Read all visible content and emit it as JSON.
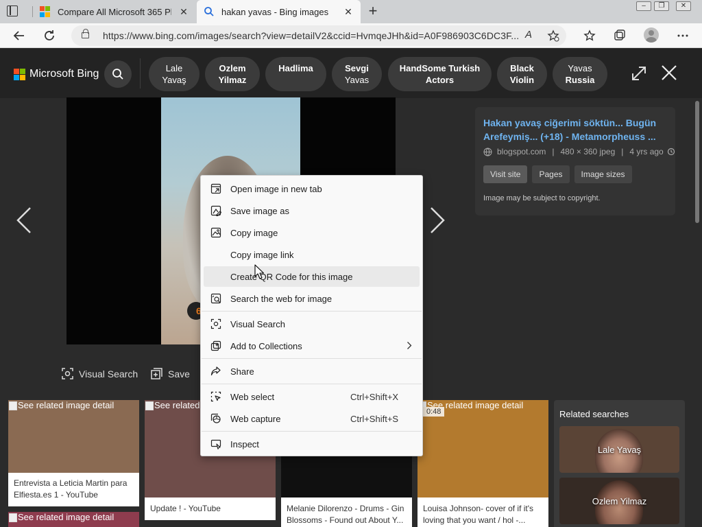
{
  "browser": {
    "tabs": [
      {
        "title": "Compare All Microsoft 365 Plans",
        "active": false
      },
      {
        "title": "hakan yavas - Bing images",
        "active": true
      }
    ],
    "new_tab_symbol": "+",
    "close_symbol": "✕",
    "window_controls": [
      "minimize-icon",
      "restore-icon",
      "close-icon"
    ],
    "url": "https://www.bing.com/images/search?view=detailV2&ccid=HvmqeJHh&id=A0F986903C6DC3F...",
    "read_aloud_label": "A",
    "toolbar_icons": [
      "read-aloud-icon",
      "add-favorite-icon",
      "favorites-icon",
      "collections-icon",
      "profile-icon",
      "more-icon"
    ]
  },
  "bing": {
    "logo_text": "Microsoft Bing",
    "logo_colors": [
      "#f25022",
      "#7fba00",
      "#00a4ef",
      "#ffb900"
    ],
    "chips": [
      {
        "line1": "Lale",
        "line2": "Yavaş"
      },
      {
        "line1": "Ozlem",
        "line2": "Yilmaz"
      },
      {
        "line1": "Hadlima",
        "line2": ""
      },
      {
        "line1": "Sevgi",
        "line2": "Yavas"
      },
      {
        "line1": "HandSome Turkish",
        "line2": "Actors"
      },
      {
        "line1": "Black",
        "line2": "Violin"
      },
      {
        "line1": "Yavas",
        "line2": "Russia"
      }
    ]
  },
  "viewer": {
    "badge_text": "6",
    "actions": {
      "visual_search": "Visual Search",
      "save": "Save"
    }
  },
  "info": {
    "title": "Hakan yavaş ciğerimi söktün... Bugün Arefeymiş... (+18) - Metamorpheuss ...",
    "source": "blogspot.com",
    "size": "480 × 360 jpeg",
    "age": "4 yrs ago",
    "buttons": [
      "Visit site",
      "Pages",
      "Image sizes"
    ],
    "note": "Image may be subject to copyright."
  },
  "related": {
    "alt_text": "See related image detail",
    "cards": [
      {
        "caption": "Entrevista a Leticia Martin para Elfiesta.es 1 - YouTube",
        "duration": ""
      },
      {
        "caption": "Update ! - YouTube",
        "duration": ""
      },
      {
        "caption": "Melanie Dilorenzo - Drums - Gin Blossoms - Found out About Y...",
        "duration": ""
      },
      {
        "caption": "Louisa Johnson- cover of if it's loving that you want / hol -...",
        "duration": "0:48"
      }
    ],
    "searches_title": "Related searches",
    "searches": [
      "Lale Yavaş",
      "Ozlem Yilmaz"
    ]
  },
  "context_menu": {
    "items": [
      {
        "label": "Open image in new tab",
        "icon": "new-tab-icon",
        "shortcut": ""
      },
      {
        "label": "Save image as",
        "icon": "save-image-icon",
        "shortcut": ""
      },
      {
        "label": "Copy image",
        "icon": "copy-image-icon",
        "shortcut": ""
      },
      {
        "label": "Copy image link",
        "icon": "",
        "shortcut": ""
      },
      {
        "label": "Create QR Code for this image",
        "icon": "",
        "shortcut": ""
      },
      {
        "label": "Search the web for image",
        "icon": "search-image-icon",
        "shortcut": ""
      },
      {
        "label": "Visual Search",
        "icon": "visual-search-icon",
        "shortcut": ""
      },
      {
        "label": "Add to Collections",
        "icon": "collections-icon",
        "shortcut": ""
      },
      {
        "label": "Share",
        "icon": "share-icon",
        "shortcut": ""
      },
      {
        "label": "Web select",
        "icon": "web-select-icon",
        "shortcut": "Ctrl+Shift+X"
      },
      {
        "label": "Web capture",
        "icon": "web-capture-icon",
        "shortcut": "Ctrl+Shift+S"
      },
      {
        "label": "Inspect",
        "icon": "inspect-icon",
        "shortcut": ""
      }
    ]
  }
}
